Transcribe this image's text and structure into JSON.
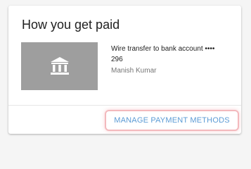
{
  "card": {
    "title": "How you get paid"
  },
  "payment_method": {
    "icon": "bank-icon",
    "description_line1": "Wire transfer to bank account ••••",
    "description_line2": "296",
    "account_holder": "Manish Kumar"
  },
  "actions": {
    "manage_label": "MANAGE PAYMENT METHODS"
  },
  "colors": {
    "thumb_background": "#9e9e9e",
    "button_text": "#5b9bd5",
    "button_highlight_border": "#f3b9bd"
  }
}
